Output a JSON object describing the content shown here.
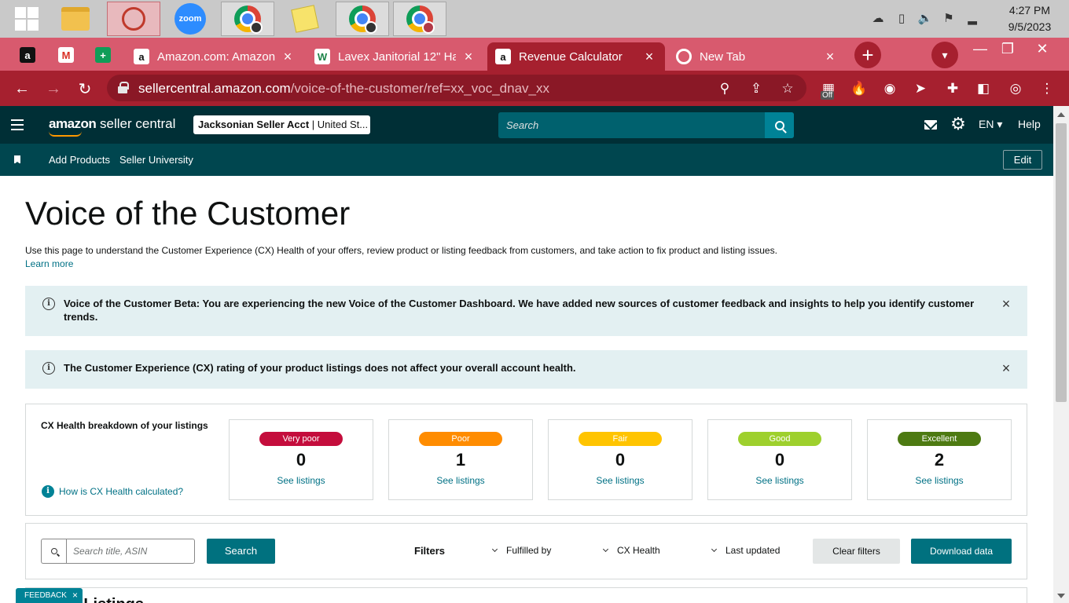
{
  "taskbar": {
    "apps": [
      {
        "name": "start",
        "icon": "windows-logo-icon"
      },
      {
        "name": "file-explorer",
        "icon": "folder-icon"
      },
      {
        "name": "snipping-tool",
        "icon": "scissors-icon"
      },
      {
        "name": "zoom",
        "icon": "zoom-icon",
        "label": "zoom"
      },
      {
        "name": "chrome-1",
        "icon": "chrome-icon"
      },
      {
        "name": "sticky-notes",
        "icon": "sticky-notes-icon"
      },
      {
        "name": "chrome-2",
        "icon": "chrome-icon"
      },
      {
        "name": "chrome-3",
        "icon": "chrome-icon"
      }
    ],
    "clock_time": "4:27 PM",
    "clock_date": "9/5/2023"
  },
  "browser": {
    "tabs": [
      {
        "label": "Amazon.com: Amazon",
        "icon": "amazon-icon",
        "active": false
      },
      {
        "label": "Lavex Janitorial 12\" Ha",
        "icon": "lavex-icon",
        "active": false
      },
      {
        "label": "Revenue Calculator",
        "icon": "amazon-icon",
        "active": true
      },
      {
        "label": "New Tab",
        "icon": "chrome-icon",
        "active": false
      }
    ],
    "url_host": "sellercentral.amazon.com",
    "url_path": "/voice-of-the-customer/ref=xx_voc_dnav_xx",
    "extension_badge": "Off"
  },
  "seller_header": {
    "logo_brand": "amazon",
    "logo_product": "seller central",
    "account_name": "Jacksonian Seller Acct",
    "account_region": " | United St...",
    "search_placeholder": "Search",
    "language": "EN",
    "help_label": "Help"
  },
  "sub_nav": {
    "links": [
      "Add Products",
      "Seller University"
    ],
    "edit_label": "Edit"
  },
  "page": {
    "title": "Voice of the Customer",
    "intro": "Use this page to understand the Customer Experience (CX) Health of your offers, review product or listing feedback from customers, and take action to fix product and listing issues.",
    "learn_more": "Learn more",
    "banner_beta": "Voice of the Customer Beta: You are experiencing the new Voice of the Customer Dashboard. We have added new sources of customer feedback and insights to help you identify customer trends.",
    "banner_rating": "The Customer Experience (CX) rating of your product listings does not affect your overall account health."
  },
  "cx_health": {
    "title": "CX Health breakdown of your listings",
    "help_link": "How is CX Health calculated?",
    "link_label": "See listings",
    "cards": [
      {
        "label": "Very poor",
        "count": "0",
        "bg": "#c40d3c",
        "fg": "#ffffff"
      },
      {
        "label": "Poor",
        "count": "1",
        "bg": "#ff8c00",
        "fg": "#ffffff"
      },
      {
        "label": "Fair",
        "count": "0",
        "bg": "#ffc400",
        "fg": "#ffffff"
      },
      {
        "label": "Good",
        "count": "0",
        "bg": "#9ed02d",
        "fg": "#ffffff"
      },
      {
        "label": "Excellent",
        "count": "2",
        "bg": "#4d7a12",
        "fg": "#ffffff"
      }
    ]
  },
  "filters": {
    "search_placeholder": "Search title, ASIN",
    "search_button": "Search",
    "label": "Filters",
    "dropdowns": [
      "Fulfilled by",
      "CX Health",
      "Last updated"
    ],
    "clear_button": "Clear filters",
    "download_button": "Download data"
  },
  "listings": {
    "title_fragment": "r Listings"
  },
  "feedback": {
    "label": "FEEDBACK",
    "close": "×"
  }
}
